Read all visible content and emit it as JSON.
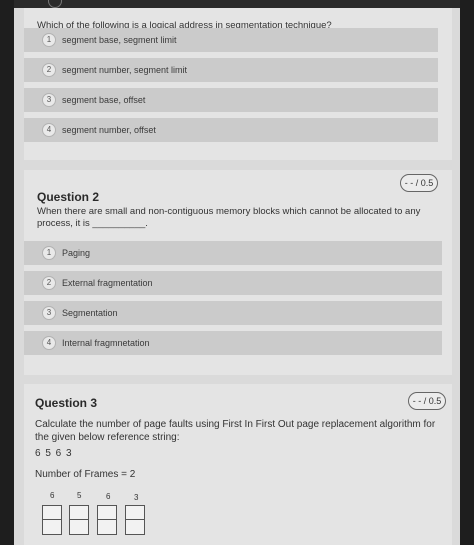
{
  "question1": {
    "text": "Which of the following is a logical address in segmentation technique?",
    "options": [
      {
        "num": "1",
        "label": "segment base, segment limit"
      },
      {
        "num": "2",
        "label": "segment number, segment limit"
      },
      {
        "num": "3",
        "label": "segment base, offset"
      },
      {
        "num": "4",
        "label": "segment number, offset"
      }
    ]
  },
  "question2": {
    "title": "Question 2",
    "score": "- - / 0.5",
    "text": "When there are small and non-contiguous memory blocks which cannot be allocated to any process, it is __________.",
    "options": [
      {
        "num": "1",
        "label": "Paging"
      },
      {
        "num": "2",
        "label": "External fragmentation"
      },
      {
        "num": "3",
        "label": "Segmentation"
      },
      {
        "num": "4",
        "label": "Internal fragmnetation"
      }
    ]
  },
  "question3": {
    "title": "Question 3",
    "score": "- - / 0.5",
    "text": "Calculate the number of page faults using  First In First Out page replacement algorithm for the given below reference string:",
    "reference_string": "6 5 6 3",
    "frames_label": "Number of Frames = 2",
    "frame_columns": [
      "6",
      "5",
      "6",
      "3"
    ]
  }
}
